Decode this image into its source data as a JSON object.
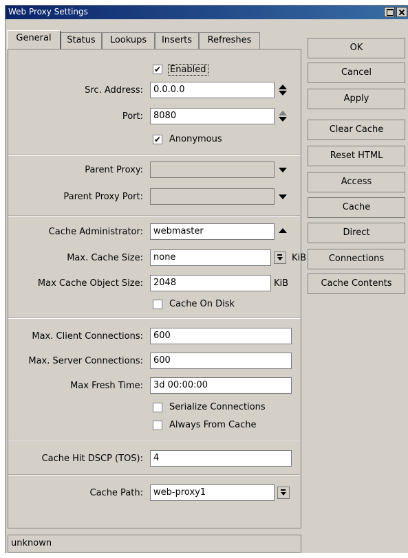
{
  "window": {
    "title": "Web Proxy Settings"
  },
  "tabs": [
    "General",
    "Status",
    "Lookups",
    "Inserts",
    "Refreshes"
  ],
  "general": {
    "enabled": {
      "label": "Enabled",
      "checked": true
    },
    "src_address": {
      "label": "Src. Address:",
      "value": "0.0.0.0"
    },
    "port": {
      "label": "Port:",
      "value": "8080"
    },
    "anonymous": {
      "label": "Anonymous",
      "checked": true
    },
    "parent_proxy": {
      "label": "Parent Proxy:",
      "value": ""
    },
    "parent_proxy_port": {
      "label": "Parent Proxy Port:",
      "value": ""
    },
    "cache_admin": {
      "label": "Cache Administrator:",
      "value": "webmaster"
    },
    "max_cache_size": {
      "label": "Max. Cache Size:",
      "value": "none",
      "unit": "KiB"
    },
    "max_cache_object_size": {
      "label": "Max Cache Object Size:",
      "value": "2048",
      "unit": "KiB"
    },
    "cache_on_disk": {
      "label": "Cache On Disk",
      "checked": false
    },
    "max_client_connections": {
      "label": "Max. Client Connections:",
      "value": "600"
    },
    "max_server_connections": {
      "label": "Max. Server Connections:",
      "value": "600"
    },
    "max_fresh_time": {
      "label": "Max Fresh Time:",
      "value": "3d 00:00:00"
    },
    "serialize_connections": {
      "label": "Serialize Connections",
      "checked": false
    },
    "always_from_cache": {
      "label": "Always From Cache",
      "checked": false
    },
    "cache_hit_dscp": {
      "label": "Cache Hit DSCP (TOS):",
      "value": "4"
    },
    "cache_path": {
      "label": "Cache Path:",
      "value": "web-proxy1"
    }
  },
  "buttons": [
    "OK",
    "Cancel",
    "Apply",
    "Clear Cache",
    "Reset HTML",
    "Access",
    "Cache",
    "Direct",
    "Connections",
    "Cache Contents"
  ],
  "status": "unknown"
}
